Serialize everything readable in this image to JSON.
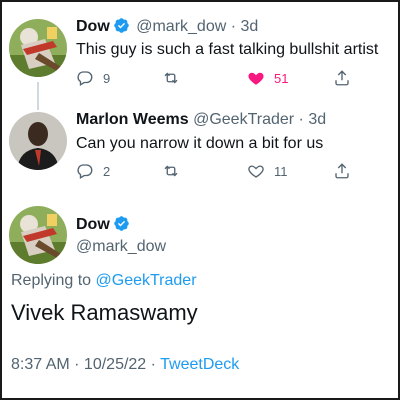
{
  "colors": {
    "accent": "#1d9bf0",
    "like": "#f91880",
    "muted": "#536471",
    "text": "#0f1419"
  },
  "tweet1": {
    "name": "Dow",
    "handle": "@mark_dow",
    "time_sep": "·",
    "time": "3d",
    "text": "This guy is such a fast talking bullshit artist",
    "replies": "9",
    "likes": "51",
    "liked": true
  },
  "tweet2": {
    "name": "Marlon Weems",
    "handle": "@GeekTrader",
    "time_sep": "·",
    "time": "3d",
    "text": "Can you narrow it down a bit for us",
    "replies": "2",
    "likes": "11"
  },
  "main_tweet": {
    "name": "Dow",
    "handle": "@mark_dow",
    "replying_prefix": "Replying to",
    "replying_handle": "@GeekTrader",
    "text": "Vivek Ramaswamy",
    "timestamp": "8:37 AM · 10/25/22 ·",
    "source": "TweetDeck"
  },
  "icons": {
    "reply": "reply-icon",
    "retweet": "retweet-icon",
    "like": "heart-icon",
    "share": "share-icon",
    "verified": "verified-badge-icon"
  }
}
